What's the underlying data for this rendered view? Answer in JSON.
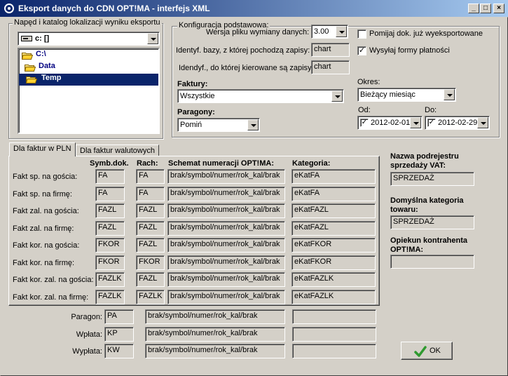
{
  "window": {
    "title": "Eksport danych do CDN OPT!MA - interfejs XML"
  },
  "drive_group": {
    "title": "Napęd i katalog lokalizacji wyniku eksportu",
    "drive": "c: []",
    "tree": [
      "C:\\",
      "Data",
      "Temp"
    ]
  },
  "config": {
    "title": "Konfiguracja podstawowa:",
    "version_label": "Wersja pliku wymiany danych:",
    "version_value": "3.00",
    "db_from_label": "Identyf. bazy, z której pochodzą zapisy:",
    "db_from_value": "chart",
    "db_to_label": "Idendyf., do której kierowane są zapisy",
    "db_to_value": "chart",
    "skip_label": "Pomijaj dok. już wyeksportowane",
    "skip_checked": false,
    "send_payment_label": "Wysyłaj formy płatności",
    "send_payment_checked": true,
    "faktury_label": "Faktury:",
    "faktury_value": "Wszystkie",
    "paragony_label": "Paragony:",
    "paragony_value": "Pomiń",
    "okres_label": "Okres:",
    "okres_value": "Bieżący miesiąc",
    "od_label": "Od:",
    "od_value": "2012-02-01",
    "do_label": "Do:",
    "do_value": "2012-02-29",
    "check_mark": "✓"
  },
  "tabs": [
    "Dla faktur w PLN",
    "Dla faktur walutowych"
  ],
  "table": {
    "headers": {
      "symb": "Symb.dok.",
      "rach": "Rach:",
      "schemat": "Schemat numeracji OPT!MA:",
      "kategoria": "Kategoria:"
    },
    "rows": [
      {
        "label": "Fakt sp. na gościa:",
        "symb": "FA",
        "rach": "FA",
        "schemat": "brak/symbol/numer/rok_kal/brak",
        "kategoria": "eKatFA"
      },
      {
        "label": "Fakt sp. na firmę:",
        "symb": "FA",
        "rach": "FA",
        "schemat": "brak/symbol/numer/rok_kal/brak",
        "kategoria": "eKatFA"
      },
      {
        "label": "Fakt zal. na gościa:",
        "symb": "FAZL",
        "rach": "FAZL",
        "schemat": "brak/symbol/numer/rok_kal/brak",
        "kategoria": "eKatFAZL"
      },
      {
        "label": "Fakt zal. na firmę:",
        "symb": "FAZL",
        "rach": "FAZL",
        "schemat": "brak/symbol/numer/rok_kal/brak",
        "kategoria": "eKatFAZL"
      },
      {
        "label": "Fakt kor. na gościa:",
        "symb": "FKOR",
        "rach": "FAZL",
        "schemat": "brak/symbol/numer/rok_kal/brak",
        "kategoria": "eKatFKOR"
      },
      {
        "label": "Fakt kor. na firmę:",
        "symb": "FKOR",
        "rach": "FKOR",
        "schemat": "brak/symbol/numer/rok_kal/brak",
        "kategoria": "eKatFKOR"
      },
      {
        "label": "Fakt kor. zal. na gościa:",
        "symb": "FAZLK",
        "rach": "FAZL",
        "schemat": "brak/symbol/numer/rok_kal/brak",
        "kategoria": "eKatFAZLK"
      },
      {
        "label": "Fakt kor. zal. na firmę:",
        "symb": "FAZLK",
        "rach": "FAZLK",
        "schemat": "brak/symbol/numer/rok_kal/brak",
        "kategoria": "eKatFAZLK"
      }
    ]
  },
  "bottom_rows": [
    {
      "label": "Paragon:",
      "symb": "PA",
      "schemat": "brak/symbol/numer/rok_kal/brak",
      "kategoria": ""
    },
    {
      "label": "Wpłata:",
      "symb": "KP",
      "schemat": "brak/symbol/numer/rok_kal/brak",
      "kategoria": ""
    },
    {
      "label": "Wypłata:",
      "symb": "KW",
      "schemat": "brak/symbol/numer/rok_kal/brak",
      "kategoria": ""
    }
  ],
  "right_panel": {
    "vat_label": "Nazwa podrejestru sprzedaży VAT:",
    "vat_value": "SPRZEDAŻ",
    "cat_label": "Domyślna kategoria towaru:",
    "cat_value": "SPRZEDAŻ",
    "opiekun_label": "Opiekun kontrahenta OPT!MA:",
    "opiekun_value": ""
  },
  "ok_button": {
    "label": "OK"
  },
  "colors": {
    "title_start": "#0a246a",
    "title_end": "#a6caf0",
    "selection": "#0a246a",
    "ok_check": "#2f9a2f"
  }
}
